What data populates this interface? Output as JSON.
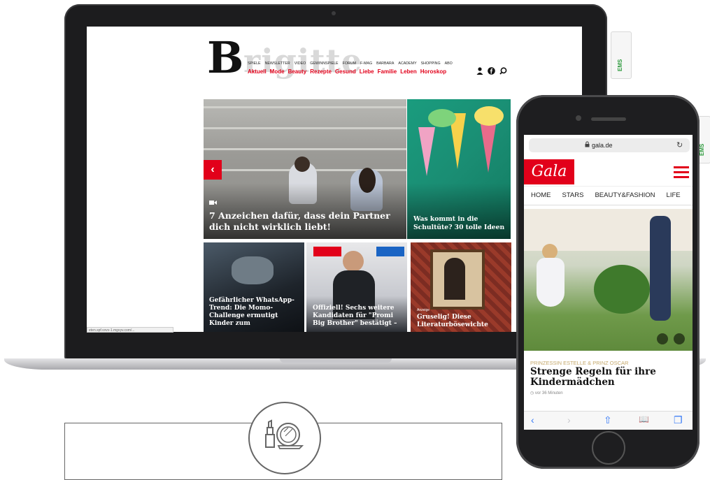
{
  "laptop": {
    "status_url": "eten.spf.vvvv-1.mgvyv.com/...",
    "brigitte": {
      "logo_letter": "B",
      "logo_rest": "rigitte",
      "top_nav": [
        "SPIELE",
        "NEWSLETTER",
        "VIDEO",
        "GEWINNSPIELE",
        "FORUM",
        "F-MAG",
        "BARBARA",
        "ACADEMY",
        "SHOPPING",
        "ABO"
      ],
      "main_nav": [
        "Aktuell",
        "Mode",
        "Beauty",
        "Rezepte",
        "Gesund",
        "Liebe",
        "Familie",
        "Leben",
        "Horoskop"
      ],
      "icons": [
        "user-icon",
        "facebook-icon",
        "search-icon"
      ],
      "hero": {
        "title": "7 Anzeichen dafür, dass dein Partner dich nicht wirklich liebt!",
        "prev": "‹",
        "next": "›"
      },
      "side_tile": {
        "title": "Was kommt in die Schultüte? 30 tolle Ideen"
      },
      "tiles": [
        {
          "title": "Gefährlicher WhatsApp-Trend: Die Momo-Challenge ermutigt Kinder zum"
        },
        {
          "title": "Offiziell! Sechs weitere Kandidaten für \"Promi Big Brother\" bestätigt –"
        },
        {
          "kicker": "Anzeige",
          "title": "Gruselig! Diese Literaturbösewichte"
        }
      ]
    }
  },
  "phone": {
    "url": "gala.de",
    "logo": "Gala",
    "nav": [
      "HOME",
      "STARS",
      "BEAUTY&FASHION",
      "LIFE"
    ],
    "kicker": "PRINZESSIN ESTELLE & PRINZ OSCAR",
    "title": "Strenge Regeln für ihre Kindermädchen",
    "time": "vor 36 Minuten",
    "toolbar": [
      "‹",
      "›",
      "⇧",
      "📖",
      "❐"
    ]
  },
  "tags": [
    "EMS",
    "EMS"
  ],
  "colors": {
    "accent": "#e2001a",
    "dark": "#1c1c1e",
    "gold": "#c4a86b"
  }
}
